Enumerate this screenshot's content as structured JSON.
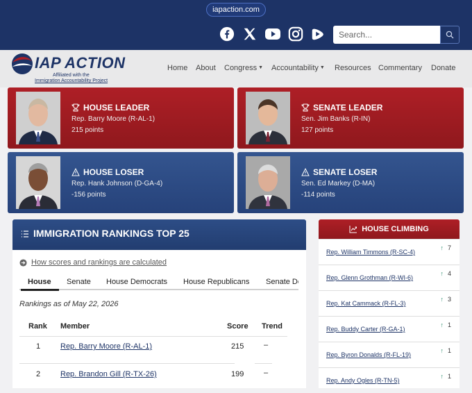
{
  "url": "iapaction.com",
  "social": [
    "facebook-icon",
    "x-icon",
    "youtube-icon",
    "instagram-icon",
    "rumble-icon"
  ],
  "search": {
    "placeholder": "Search..."
  },
  "brand": {
    "name": "IAP ACTION",
    "affiliated": "Affiliated with the",
    "org": "Immigration Accountability Project",
    "colors": {
      "navy": "#1d3366",
      "red": "#ae1f26"
    }
  },
  "nav": [
    {
      "label": "Home",
      "dropdown": false
    },
    {
      "label": "About",
      "dropdown": false
    },
    {
      "label": "Congress",
      "dropdown": true
    },
    {
      "label": "Accountability",
      "dropdown": true
    },
    {
      "label": "Resources",
      "dropdown": false
    },
    {
      "label": "Commentary",
      "dropdown": false
    },
    {
      "label": "Donate",
      "dropdown": false
    }
  ],
  "cards": {
    "house_leader": {
      "title": "HOUSE LEADER",
      "name": "Rep. Barry Moore (R-AL-1)",
      "points": "215 points",
      "icon": "trophy-icon"
    },
    "senate_leader": {
      "title": "SENATE LEADER",
      "name": "Sen. Jim Banks (R-IN)",
      "points": "127 points",
      "icon": "trophy-icon"
    },
    "house_loser": {
      "title": "HOUSE LOSER",
      "name": "Rep. Hank Johnson (D-GA-4)",
      "points": "-156 points",
      "icon": "warning-icon"
    },
    "senate_loser": {
      "title": "SENATE LOSER",
      "name": "Sen. Ed Markey (D-MA)",
      "points": "-114 points",
      "icon": "warning-icon"
    }
  },
  "rankings": {
    "title": "IMMIGRATION RANKINGS TOP 25",
    "howto": "How scores and rankings are calculated",
    "tabs": [
      "House",
      "Senate",
      "House Democrats",
      "House Republicans",
      "Senate De"
    ],
    "as_of": "Rankings as of May 22, 2026",
    "columns": [
      "Rank",
      "Member",
      "Score",
      "Trend"
    ],
    "rows": [
      {
        "rank": "1",
        "member": "Rep. Barry Moore (R-AL-1)",
        "score": "215",
        "trend": "–"
      },
      {
        "rank": "2",
        "member": "Rep. Brandon Gill (R-TX-26)",
        "score": "199",
        "trend": "–"
      }
    ]
  },
  "climbing": {
    "title": "HOUSE CLIMBING",
    "rows": [
      {
        "name": "Rep. William Timmons (R-SC-4)",
        "change": "7"
      },
      {
        "name": "Rep. Glenn Grothman (R-WI-6)",
        "change": "4"
      },
      {
        "name": "Rep. Kat Cammack (R-FL-3)",
        "change": "3"
      },
      {
        "name": "Rep. Buddy Carter (R-GA-1)",
        "change": "1"
      },
      {
        "name": "Rep. Byron Donalds (R-FL-19)",
        "change": "1"
      },
      {
        "name": "Rep. Andy Ogles (R-TN-5)",
        "change": "1"
      }
    ]
  }
}
